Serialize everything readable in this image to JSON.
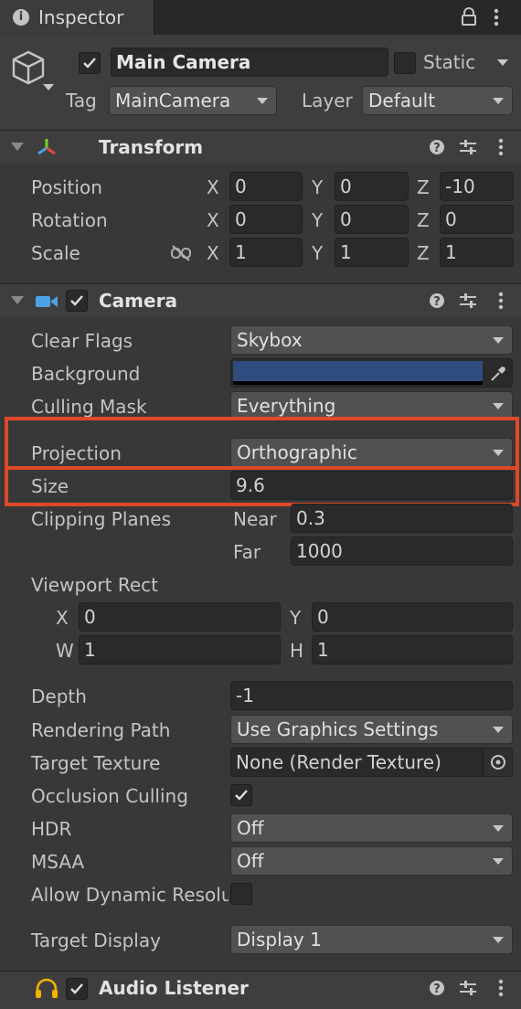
{
  "window": {
    "tab_title": "Inspector"
  },
  "object": {
    "name": "Main Camera",
    "static_label": "Static",
    "tag_label": "Tag",
    "tag_value": "MainCamera",
    "layer_label": "Layer",
    "layer_value": "Default"
  },
  "transform": {
    "title": "Transform",
    "position": {
      "label": "Position",
      "x": "0",
      "y": "0",
      "z": "-10"
    },
    "rotation": {
      "label": "Rotation",
      "x": "0",
      "y": "0",
      "z": "0"
    },
    "scale": {
      "label": "Scale",
      "x": "1",
      "y": "1",
      "z": "1"
    },
    "axis": {
      "x": "X",
      "y": "Y",
      "z": "Z"
    }
  },
  "camera": {
    "title": "Camera",
    "clear_flags": {
      "label": "Clear Flags",
      "value": "Skybox"
    },
    "background": {
      "label": "Background",
      "color": "#2f4c7e"
    },
    "culling_mask": {
      "label": "Culling Mask",
      "value": "Everything"
    },
    "projection": {
      "label": "Projection",
      "value": "Orthographic"
    },
    "size": {
      "label": "Size",
      "value": "9.6"
    },
    "clipping": {
      "label": "Clipping Planes",
      "near_label": "Near",
      "near": "0.3",
      "far_label": "Far",
      "far": "1000"
    },
    "viewport": {
      "label": "Viewport Rect",
      "x_label": "X",
      "x": "0",
      "y_label": "Y",
      "y": "0",
      "w_label": "W",
      "w": "1",
      "h_label": "H",
      "h": "1"
    },
    "depth": {
      "label": "Depth",
      "value": "-1"
    },
    "rendering_path": {
      "label": "Rendering Path",
      "value": "Use Graphics Settings"
    },
    "target_texture": {
      "label": "Target Texture",
      "value": "None (Render Texture)"
    },
    "occlusion": {
      "label": "Occlusion Culling",
      "checked": true
    },
    "hdr": {
      "label": "HDR",
      "value": "Off"
    },
    "msaa": {
      "label": "MSAA",
      "value": "Off"
    },
    "dynamic_res": {
      "label": "Allow Dynamic Resolu",
      "checked": false
    },
    "target_display": {
      "label": "Target Display",
      "value": "Display 1"
    }
  },
  "audio": {
    "title": "Audio Listener"
  },
  "colors": {
    "highlight": "#e0482a",
    "accent_blue": "#4aa3e8",
    "headphone": "#f0b400"
  }
}
